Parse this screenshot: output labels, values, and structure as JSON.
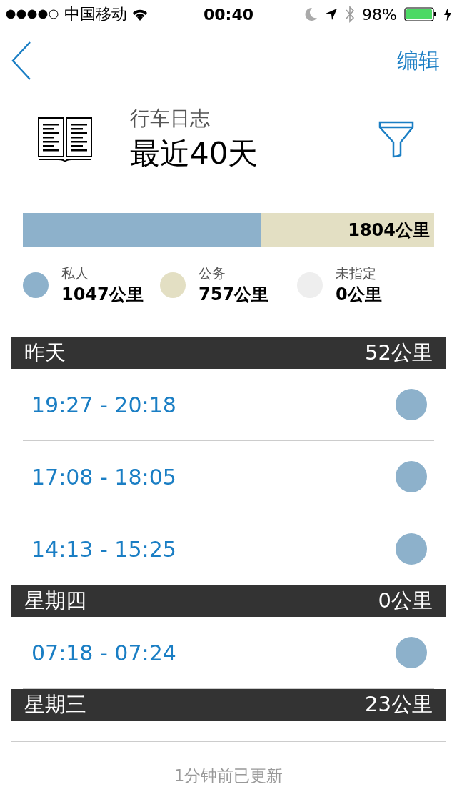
{
  "status_bar": {
    "carrier": "中国移动",
    "time": "00:40",
    "battery": "98%"
  },
  "nav": {
    "edit": "编辑"
  },
  "header": {
    "subtitle": "行车日志",
    "title": "最近40天"
  },
  "distance_bar": {
    "level": 0.58,
    "total": "1804公里"
  },
  "legend": [
    {
      "label": "私人",
      "value": "1047公里",
      "color": "#8db1cb"
    },
    {
      "label": "公务",
      "value": "757公里",
      "color": "#e3dfc3"
    },
    {
      "label": "未指定",
      "value": "0公里",
      "color": "#eeeeee"
    }
  ],
  "sections": [
    {
      "title": "昨天",
      "distance": "52公里",
      "trips": [
        {
          "time": "19:27 - 20:18",
          "color": "#8db1cb"
        },
        {
          "time": "17:08 - 18:05",
          "color": "#8db1cb"
        },
        {
          "time": "14:13 - 15:25",
          "color": "#8db1cb"
        }
      ]
    },
    {
      "title": "星期四",
      "distance": "0公里",
      "trips": [
        {
          "time": "07:18 - 07:24",
          "color": "#8db1cb"
        }
      ]
    },
    {
      "title": "星期三",
      "distance": "23公里"
    }
  ],
  "footer": "1分钟前已更新"
}
